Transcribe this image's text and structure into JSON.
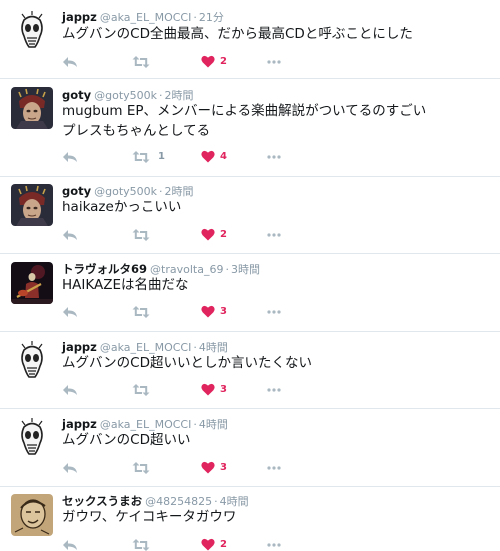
{
  "colors": {
    "like": "#e0245e",
    "icon_gray": "#aab8c2",
    "meta_gray": "#8899a6",
    "divider": "#e1e8ed"
  },
  "icons": {
    "reply": "reply-arrow-icon",
    "retweet": "retweet-icon",
    "like": "heart-icon",
    "more": "ellipsis-icon"
  },
  "tweets": [
    {
      "avatar": "sketch-face",
      "name": "jappz",
      "handle": "@aka_EL_MOCCI",
      "dot": "·",
      "time": "21分",
      "lines": [
        "ムグバンのCD全曲最高、だから最高CDと呼ぶことにした"
      ],
      "retweets": "",
      "likes": "2"
    },
    {
      "avatar": "masked-figure",
      "name": "goty",
      "handle": "@goty500k",
      "dot": "·",
      "time": "2時間",
      "lines": [
        "mugbum EP、メンバーによる楽曲解説がついてるのすごい",
        "プレスもちゃんとしてる"
      ],
      "retweets": "1",
      "likes": "4"
    },
    {
      "avatar": "masked-figure",
      "name": "goty",
      "handle": "@goty500k",
      "dot": "·",
      "time": "2時間",
      "lines": [
        "haikazeかっこいい"
      ],
      "retweets": "",
      "likes": "2"
    },
    {
      "avatar": "guitarist-stage",
      "name": "トラヴォルタ69",
      "handle": "@travolta_69",
      "dot": "·",
      "time": "3時間",
      "lines": [
        "HAIKAZEは名曲だな"
      ],
      "retweets": "",
      "likes": "3"
    },
    {
      "avatar": "sketch-face",
      "name": "jappz",
      "handle": "@aka_EL_MOCCI",
      "dot": "·",
      "time": "4時間",
      "lines": [
        "ムグバンのCD超いいとしか言いたくない"
      ],
      "retweets": "",
      "likes": "3"
    },
    {
      "avatar": "sketch-face",
      "name": "jappz",
      "handle": "@aka_EL_MOCCI",
      "dot": "·",
      "time": "4時間",
      "lines": [
        "ムグバンのCD超いい"
      ],
      "retweets": "",
      "likes": "3"
    },
    {
      "avatar": "sepia-drawing",
      "name": "セックスうまお",
      "handle": "@48254825",
      "dot": "·",
      "time": "4時間",
      "lines": [
        "ガウワ、ケイコキータガウワ"
      ],
      "retweets": "",
      "likes": "2"
    }
  ]
}
